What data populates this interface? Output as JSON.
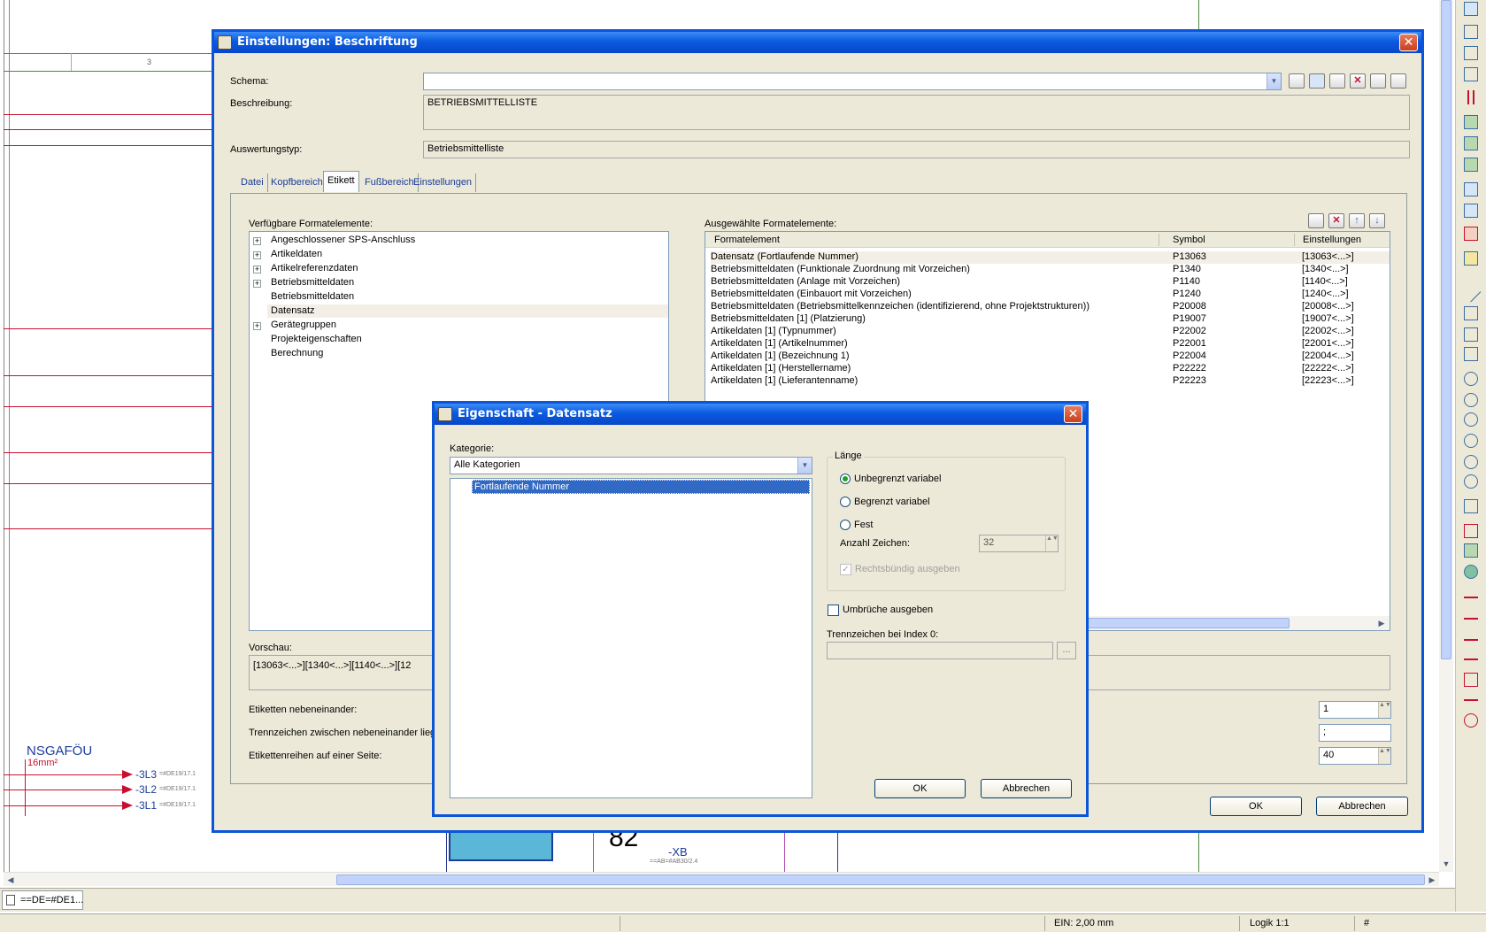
{
  "background": {
    "sheet_cell": "3",
    "label_nsgafou": "NSGAFÖU",
    "label_section": "16mm²",
    "wires": [
      {
        "name": "-3L3",
        "ref": "=#DE19/17.1"
      },
      {
        "name": "-3L2",
        "ref": "=#DE19/17.1"
      },
      {
        "name": "-3L1",
        "ref": "=#DE19/17.1"
      }
    ],
    "symbol_82": "82",
    "symbol_xb": "-XB",
    "symbol_xb_ref": "==AB=#AB30/2.4",
    "tab_label": "==DE=#DE1...",
    "status_ein": "EIN: 2,00 mm",
    "status_logik": "Logik 1:1",
    "status_hash": "#"
  },
  "main_dialog": {
    "title": "Einstellungen: Beschriftung",
    "schema_label": "Schema:",
    "schema_value": "",
    "beschreibung_label": "Beschreibung:",
    "beschreibung_value": "BETRIEBSMITTELLISTE",
    "auswertungstyp_label": "Auswertungstyp:",
    "auswertungstyp_value": "Betriebsmittelliste",
    "tabs": [
      "Datei",
      "Kopfbereich",
      "Etikett",
      "Fußbereich",
      "Einstellungen"
    ],
    "available_label": "Verfügbare Formatelemente:",
    "available_items": [
      {
        "label": "Angeschlossener SPS-Anschluss",
        "expandable": true
      },
      {
        "label": "Artikeldaten",
        "expandable": true
      },
      {
        "label": "Artikelreferenzdaten",
        "expandable": true
      },
      {
        "label": "Betriebsmitteldaten",
        "expandable": true
      },
      {
        "label": "Betriebsmitteldaten",
        "expandable": false
      },
      {
        "label": "Datensatz",
        "expandable": false
      },
      {
        "label": "Gerätegruppen",
        "expandable": true
      },
      {
        "label": "Projekteigenschaften",
        "expandable": false
      },
      {
        "label": "Berechnung",
        "expandable": false
      }
    ],
    "selected_label": "Ausgewählte Formatelemente:",
    "columns": [
      "Formatelement",
      "Symbol",
      "Einstellungen"
    ],
    "rows": [
      [
        "Datensatz (Fortlaufende Nummer)",
        "P13063",
        "[13063<...>]"
      ],
      [
        "Betriebsmitteldaten (Funktionale Zuordnung mit Vorzeichen)",
        "P1340",
        "[1340<...>]"
      ],
      [
        "Betriebsmitteldaten (Anlage mit Vorzeichen)",
        "P1140",
        "[1140<...>]"
      ],
      [
        "Betriebsmitteldaten (Einbauort mit Vorzeichen)",
        "P1240",
        "[1240<...>]"
      ],
      [
        "Betriebsmitteldaten (Betriebsmittelkennzeichen (identifizierend, ohne Projektstrukturen))",
        "P20008",
        "[20008<...>]"
      ],
      [
        "Betriebsmitteldaten [1] (Platzierung)",
        "P19007",
        "[19007<...>]"
      ],
      [
        "Artikeldaten [1] (Typnummer)",
        "P22002",
        "[22002<...>]"
      ],
      [
        "Artikeldaten [1] (Artikelnummer)",
        "P22001",
        "[22001<...>]"
      ],
      [
        "Artikeldaten [1] (Bezeichnung 1)",
        "P22004",
        "[22004<...>]"
      ],
      [
        "Artikeldaten [1] (Herstellername)",
        "P22222",
        "[22222<...>]"
      ],
      [
        "Artikeldaten [1] (Lieferantenname)",
        "P22223",
        "[22223<...>]"
      ]
    ],
    "vorschau_label": "Vorschau:",
    "vorschau_value": "[13063<...>][1340<...>][1140<...>][12",
    "etiketten_nebeneinander_label": "Etiketten nebeneinander:",
    "etiketten_nebeneinander_value": "1",
    "trennzeichen_label": "Trennzeichen zwischen nebeneinander liege",
    "trennzeichen_value": ";",
    "etikettenreihen_label": "Etikettenreihen auf einer Seite:",
    "etikettenreihen_value": "40",
    "ok_label": "OK",
    "cancel_label": "Abbrechen"
  },
  "sub_dialog": {
    "title": "Eigenschaft - Datensatz",
    "kategorie_label": "Kategorie:",
    "kategorie_value": "Alle Kategorien",
    "list_items": [
      "Fortlaufende Nummer"
    ],
    "laenge_label": "Länge",
    "radio_unbegrenzt": "Unbegrenzt variabel",
    "radio_begrenzt": "Begrenzt variabel",
    "radio_fest": "Fest",
    "anzahl_label": "Anzahl Zeichen:",
    "anzahl_value": "32",
    "rechtsbuendig_label": "Rechtsbündig ausgeben",
    "umbrueche_label": "Umbrüche ausgeben",
    "trennzeichen_index_label": "Trennzeichen bei Index 0:",
    "trennzeichen_index_value": "",
    "dots_label": "...",
    "ok_label": "OK",
    "cancel_label": "Abbrechen"
  }
}
